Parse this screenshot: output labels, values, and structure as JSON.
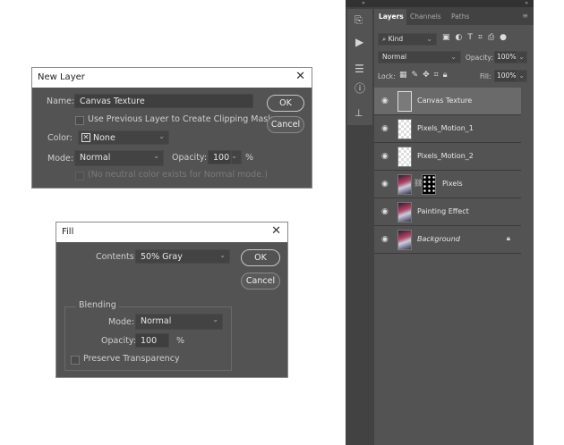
{
  "new_layer": {
    "title": "New Layer",
    "name_label": "Name:",
    "name_value": "Canvas Texture",
    "clip_label": "Use Previous Layer to Create Clipping Mask",
    "color_label": "Color:",
    "color_value": "None",
    "mode_label": "Mode:",
    "mode_value": "Normal",
    "opacity_label": "Opacity:",
    "opacity_value": "100",
    "percent": "%",
    "neutral_label": "(No neutral color exists for Normal mode.)",
    "ok": "OK",
    "cancel": "Cancel",
    "close": "✕"
  },
  "fill": {
    "title": "Fill",
    "contents_label": "Contents:",
    "contents_value": "50% Gray",
    "blending_label": "Blending",
    "mode_label": "Mode:",
    "mode_value": "Normal",
    "opacity_label": "Opacity:",
    "opacity_value": "100",
    "percent": "%",
    "preserve_label": "Preserve Transparency",
    "ok": "OK",
    "cancel": "Cancel",
    "close": "✕"
  },
  "layers_panel": {
    "tabs": [
      "Layers",
      "Channels",
      "Paths"
    ],
    "filter_kind": "Kind",
    "blend_mode": "Normal",
    "opacity_label": "Opacity:",
    "opacity_value": "100%",
    "lock_label": "Lock:",
    "fill_label": "Fill:",
    "fill_value": "100%",
    "layers": [
      {
        "name": "Canvas Texture"
      },
      {
        "name": "Pixels_Motion_1"
      },
      {
        "name": "Pixels_Motion_2"
      },
      {
        "name": "Pixels"
      },
      {
        "name": "Painting Effect"
      },
      {
        "name": "Background"
      }
    ]
  }
}
